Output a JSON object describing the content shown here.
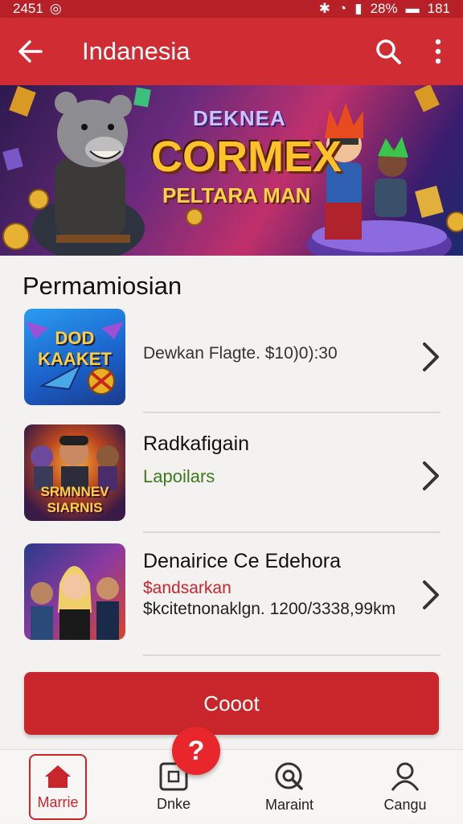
{
  "status_bar": {
    "time": "2451",
    "battery": "28%",
    "extra": "181"
  },
  "app_bar": {
    "title": "Indanesia",
    "back_icon": "arrow-left-icon",
    "search_icon": "search-icon",
    "menu_icon": "more-vertical-icon"
  },
  "banner": {
    "line1": "DEKNEA",
    "line2": "CORMEX",
    "line3": "PELTARA MAN"
  },
  "section": {
    "title": "Permamiosian"
  },
  "items": [
    {
      "thumb_text": "DOD KAAKET",
      "title": "",
      "subtitle": "",
      "detail": "Dewkan Flagte. $10)0):30"
    },
    {
      "thumb_text": "SRMNNEV SIARNIS",
      "title": "Radkafigain",
      "subtitle": "Lapoilars",
      "detail": ""
    },
    {
      "thumb_text": "",
      "title": "Denairice Ce Edehora",
      "subtitle": "$andsarkan",
      "detail": "$kcitetnonaklgn. 1200/3338,99km"
    }
  ],
  "colors": {
    "primary": "#cf2d33",
    "accent_green": "#3f7a1c",
    "accent_red": "#c9262c"
  },
  "cta": {
    "label": "Cooot"
  },
  "fab": {
    "label": "?"
  },
  "nav": [
    {
      "label": "Marrie",
      "icon": "home-icon"
    },
    {
      "label": "Dnke",
      "icon": "square-icon"
    },
    {
      "label": "Maraint",
      "icon": "search-circle-icon"
    },
    {
      "label": "Cangu",
      "icon": "person-icon"
    }
  ]
}
